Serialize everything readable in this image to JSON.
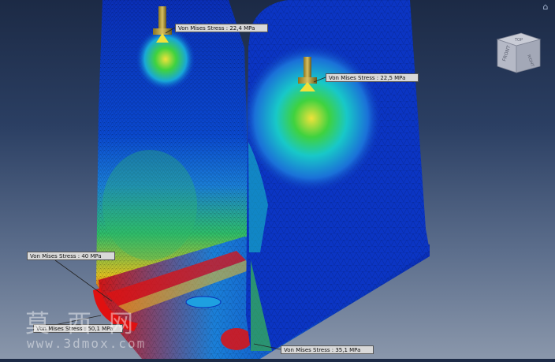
{
  "app": {
    "home_glyph": "⌂"
  },
  "annotations": [
    {
      "id": "bolt-left",
      "text": "Von Mises Stress : 22,4 MPa"
    },
    {
      "id": "bolt-right",
      "text": "Von Mises Stress : 22,5 MPa"
    },
    {
      "id": "bend-left",
      "text": "Von Mises Stress : 40 MPa"
    },
    {
      "id": "corner-bottom",
      "text": "Von Mises Stress : 50,1 MPa"
    },
    {
      "id": "base-right",
      "text": "Von Mises Stress : 35,1 MPa"
    }
  ],
  "viewcube": {
    "faces": [
      "FRONT",
      "TOP",
      "RIGHT"
    ]
  },
  "watermark": {
    "chars": "莫西网",
    "site": "www.3dmox.com"
  },
  "colors": {
    "stress_low": "#0a2fb8",
    "stress_mid": "#18c8c8",
    "stress_mid2": "#3fd23f",
    "stress_high": "#f0e23a",
    "stress_max": "#e01010",
    "callout_bg": "#d9d9d9"
  },
  "icons": [
    "home-icon",
    "viewcube-icon",
    "bolt-icon"
  ]
}
